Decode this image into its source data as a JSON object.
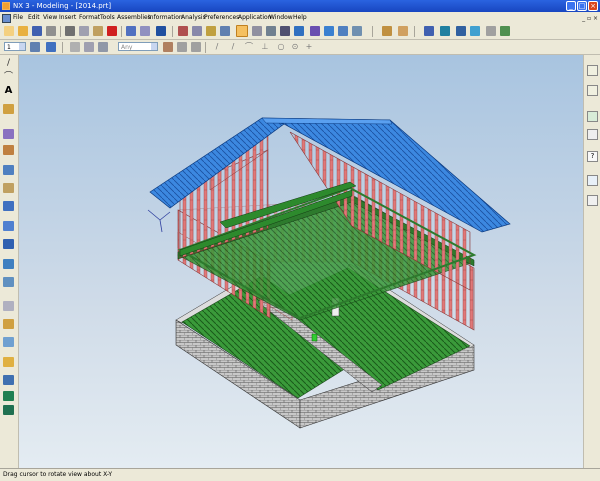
{
  "window": {
    "title": "NX 3 - Modeling - [2014.prt]"
  },
  "menu": {
    "items": [
      "File",
      "Edit",
      "View",
      "Insert",
      "Format",
      "Tools",
      "Assemblies",
      "Information",
      "Analysis",
      "Preferences",
      "Application",
      "Window",
      "Help"
    ]
  },
  "toolbar2": {
    "layer_value": "1",
    "filter_value": "Any"
  },
  "status": {
    "message": "Drag cursor to rotate view about X-Y"
  },
  "colors": {
    "roof": "#3c88e0",
    "studs": "#e07878",
    "floor": "#3a9a3a",
    "block": "#b8b8b8"
  },
  "icons": {
    "right_toolbar": [
      "assembly-navigator-icon",
      "part-navigator-icon",
      "web-browser-icon",
      "roles-icon",
      "help-icon",
      "history-icon",
      "properties-icon"
    ]
  }
}
